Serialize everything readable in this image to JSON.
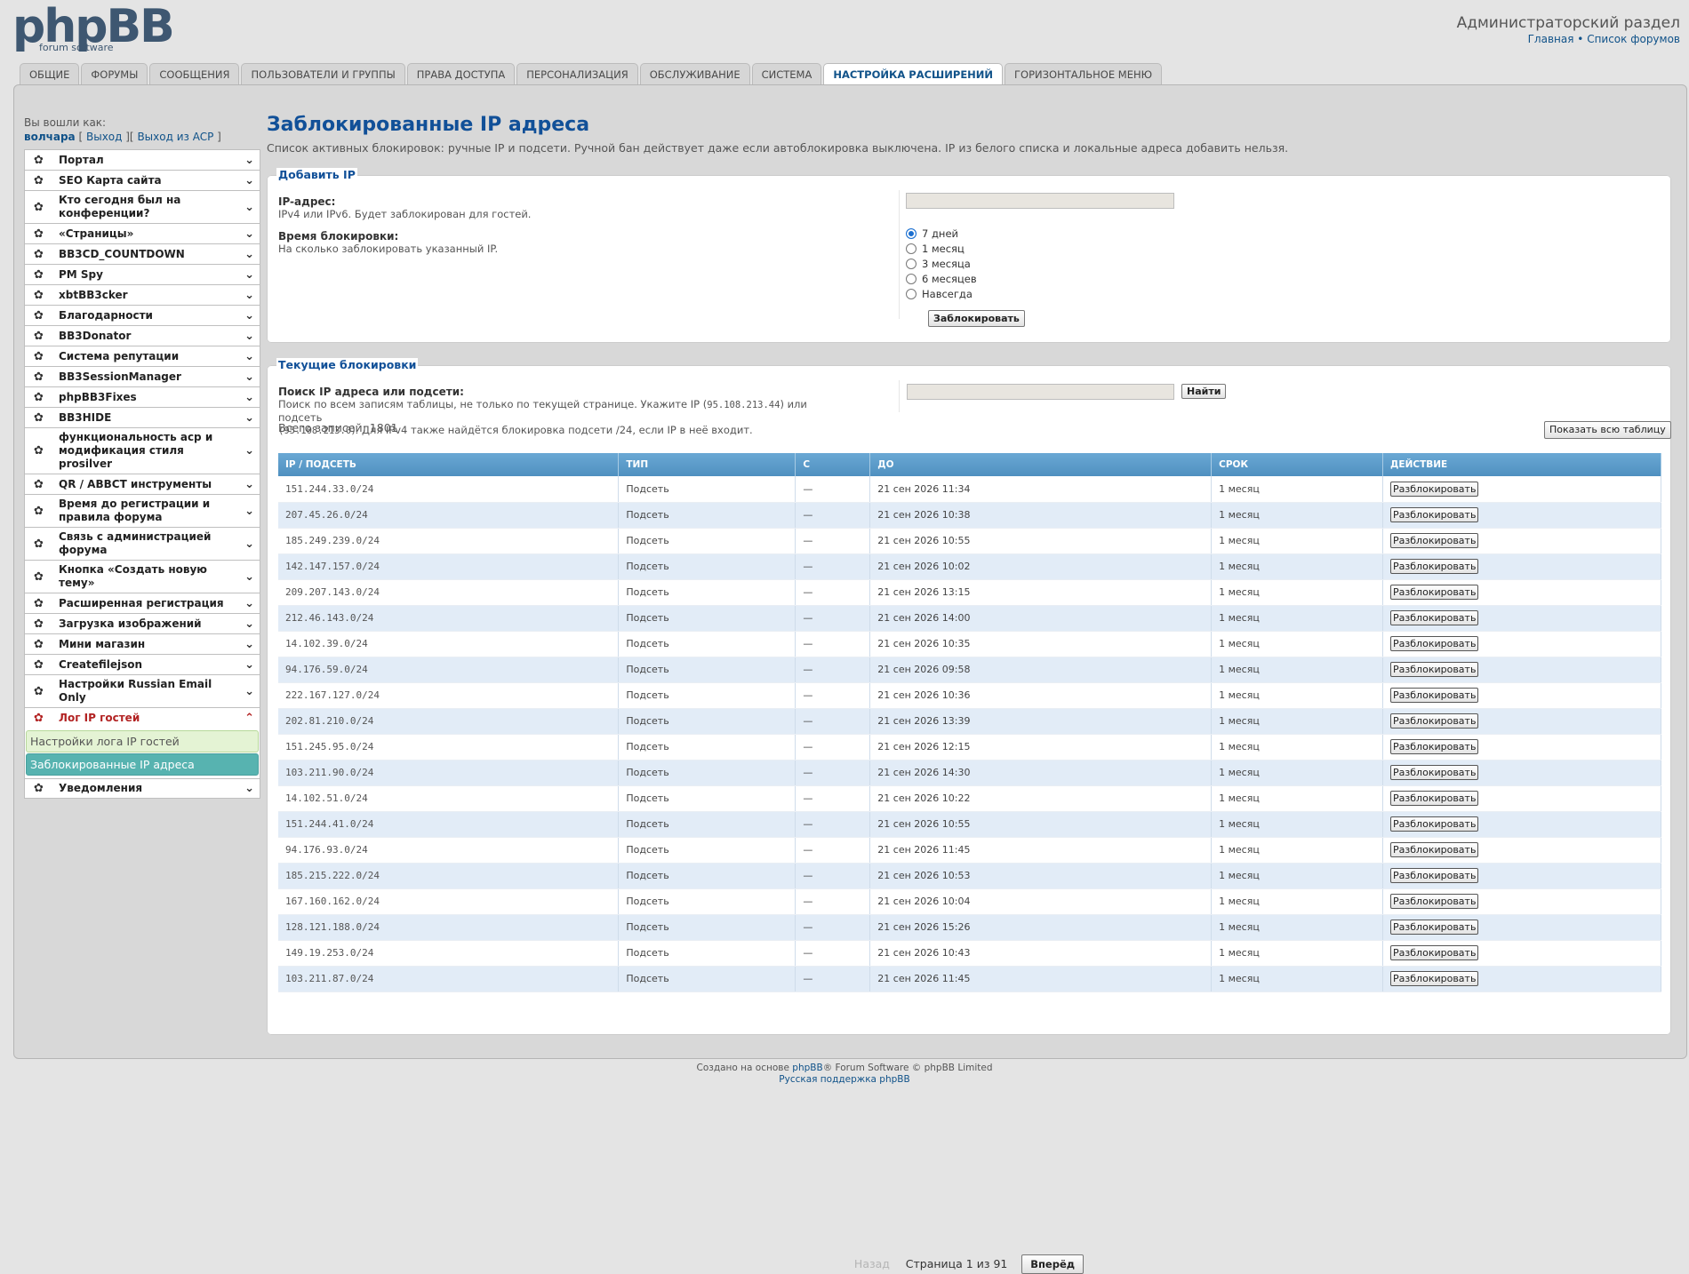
{
  "header": {
    "logo_text": "phpBB",
    "logo_sub": "forum software",
    "admin_title": "Администраторский раздел",
    "link_home": "Главная",
    "link_sep": "•",
    "link_forums": "Список форумов"
  },
  "tabs": [
    {
      "label": "Общие"
    },
    {
      "label": "Форумы"
    },
    {
      "label": "Сообщения"
    },
    {
      "label": "Пользователи и группы"
    },
    {
      "label": "Права доступа"
    },
    {
      "label": "Персонализация"
    },
    {
      "label": "Обслуживание"
    },
    {
      "label": "Система"
    },
    {
      "label": "Настройка расширений",
      "active": true
    },
    {
      "label": "Горизонтальное меню"
    }
  ],
  "login": {
    "label": "Вы вошли как:",
    "user": "волчара",
    "logout": "Выход",
    "logout_acp": "Выход из ACP"
  },
  "menu": [
    "Портал",
    "SEO Карта сайта",
    "Кто сегодня был на конференции?",
    "«Страницы»",
    "BB3CD_COUNTDOWN",
    "PM Spy",
    "xbtBB3cker",
    "Благодарности",
    "BB3Donator",
    "Система репутации",
    "BB3SessionManager",
    "phpBB3Fixes",
    "BB3HIDE",
    "функциональность acp и модификация стиля prosilver",
    "QR / ABBCT инструменты",
    "Время до регистрации и правила форума",
    "Связь с администрацией форума",
    "Кнопка «Создать новую тему»",
    "Расширенная регистрация",
    "Загрузка изображений",
    "Мини магазин",
    "Createfilejson",
    "Настройки Russian Email Only"
  ],
  "menu_open": {
    "label": "Лог IP гостей",
    "sub1": "Настройки лога IP гостей",
    "sub2": "Заблокированные IP адреса"
  },
  "menu_last": "Уведомления",
  "page": {
    "title": "Заблокированные IP адреса",
    "description": "Список активных блокировок: ручные IP и подсети. Ручной бан действует даже если автоблокировка выключена. IP из белого списка и локальные адреса добавить нельзя."
  },
  "add_ip": {
    "legend": "Добавить IP",
    "ip_label": "IP-адрес:",
    "ip_hint": "IPv4 или IPv6. Будет заблокирован для гостей.",
    "time_label": "Время блокировки:",
    "time_hint": "На сколько заблокировать указанный IP.",
    "options": [
      "7 дней",
      "1 месяц",
      "3 месяца",
      "6 месяцев",
      "Навсегда"
    ],
    "selected": "7 дней",
    "submit": "Заблокировать"
  },
  "current": {
    "legend": "Текущие блокировки",
    "search_label": "Поиск IP адреса или подсети:",
    "search_hint_1": "Поиск по всем записям таблицы, не только по текущей странице. Укажите IP (",
    "search_hint_ip": "95.108.213.44",
    "search_hint_2": ") или подсеть",
    "search_hint_net": "(95.108.213.0",
    "search_hint_3": "). Для IPv4 также найдётся блокировка подсети /24, если IP в неё входит.",
    "search_button": "Найти",
    "total": "Всего записей: 1801",
    "show_all": "Показать всю таблицу",
    "columns": [
      "IP / подсеть",
      "Тип",
      "С",
      "До",
      "Срок",
      "Действие"
    ],
    "unban": "Разблокировать",
    "rows": [
      [
        "151.244.33.0/24",
        "Подсеть",
        "—",
        "21 сен 2026 11:34",
        "1 месяц"
      ],
      [
        "207.45.26.0/24",
        "Подсеть",
        "—",
        "21 сен 2026 10:38",
        "1 месяц"
      ],
      [
        "185.249.239.0/24",
        "Подсеть",
        "—",
        "21 сен 2026 10:55",
        "1 месяц"
      ],
      [
        "142.147.157.0/24",
        "Подсеть",
        "—",
        "21 сен 2026 10:02",
        "1 месяц"
      ],
      [
        "209.207.143.0/24",
        "Подсеть",
        "—",
        "21 сен 2026 13:15",
        "1 месяц"
      ],
      [
        "212.46.143.0/24",
        "Подсеть",
        "—",
        "21 сен 2026 14:00",
        "1 месяц"
      ],
      [
        "14.102.39.0/24",
        "Подсеть",
        "—",
        "21 сен 2026 10:35",
        "1 месяц"
      ],
      [
        "94.176.59.0/24",
        "Подсеть",
        "—",
        "21 сен 2026 09:58",
        "1 месяц"
      ],
      [
        "222.167.127.0/24",
        "Подсеть",
        "—",
        "21 сен 2026 10:36",
        "1 месяц"
      ],
      [
        "202.81.210.0/24",
        "Подсеть",
        "—",
        "21 сен 2026 13:39",
        "1 месяц"
      ],
      [
        "151.245.95.0/24",
        "Подсеть",
        "—",
        "21 сен 2026 12:15",
        "1 месяц"
      ],
      [
        "103.211.90.0/24",
        "Подсеть",
        "—",
        "21 сен 2026 14:30",
        "1 месяц"
      ],
      [
        "14.102.51.0/24",
        "Подсеть",
        "—",
        "21 сен 2026 10:22",
        "1 месяц"
      ],
      [
        "151.244.41.0/24",
        "Подсеть",
        "—",
        "21 сен 2026 10:55",
        "1 месяц"
      ],
      [
        "94.176.93.0/24",
        "Подсеть",
        "—",
        "21 сен 2026 11:45",
        "1 месяц"
      ],
      [
        "185.215.222.0/24",
        "Подсеть",
        "—",
        "21 сен 2026 10:53",
        "1 месяц"
      ],
      [
        "167.160.162.0/24",
        "Подсеть",
        "—",
        "21 сен 2026 10:04",
        "1 месяц"
      ],
      [
        "128.121.188.0/24",
        "Подсеть",
        "—",
        "21 сен 2026 15:26",
        "1 месяц"
      ],
      [
        "149.19.253.0/24",
        "Подсеть",
        "—",
        "21 сен 2026 10:43",
        "1 месяц"
      ],
      [
        "103.211.87.0/24",
        "Подсеть",
        "—",
        "21 сен 2026 11:45",
        "1 месяц"
      ]
    ],
    "pager": {
      "prev": "Назад",
      "info": "Страница 1 из 91",
      "next": "Вперёд"
    }
  },
  "footer": {
    "line1_pre": "Создано на основе",
    "line1_link": "phpBB",
    "line1_post": "® Forum Software © phpBB Limited",
    "line2": "Русская поддержка phpBB"
  }
}
